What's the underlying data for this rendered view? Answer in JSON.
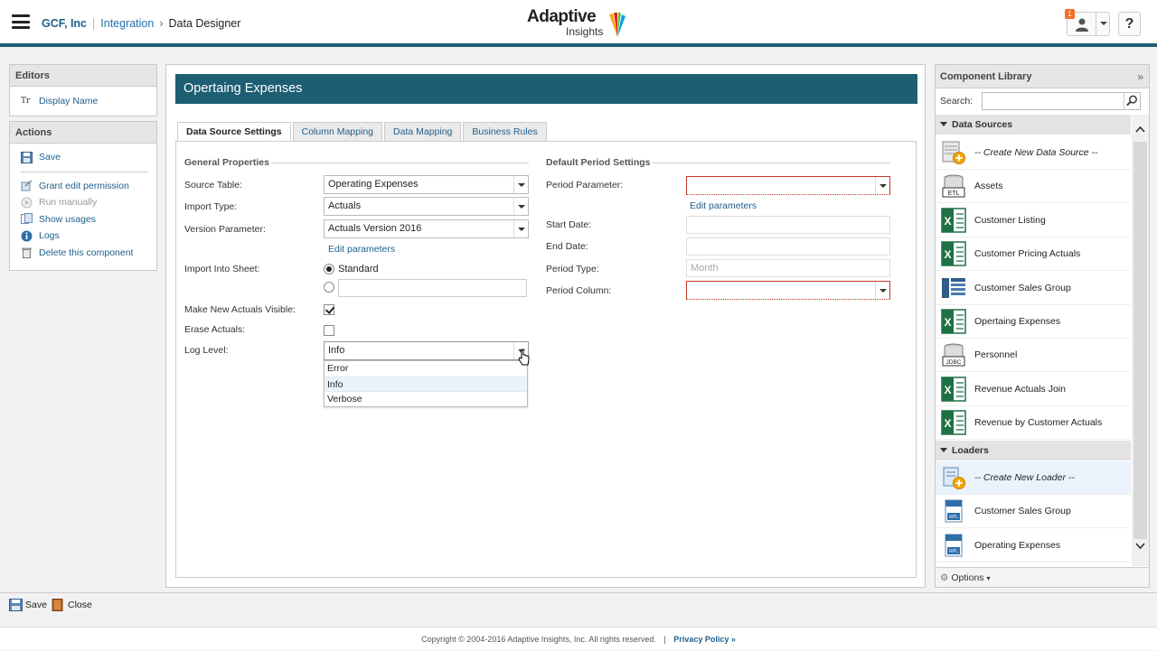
{
  "header": {
    "company": "GCF, Inc",
    "crumb_integration": "Integration",
    "crumb_current": "Data Designer",
    "logo_line1": "Adaptive",
    "logo_line2": "Insights",
    "notification_count": "1",
    "help_label": "?"
  },
  "left": {
    "editors_title": "Editors",
    "display_name": "Display Name",
    "actions_title": "Actions",
    "save": "Save",
    "grant": "Grant edit permission",
    "run_manually": "Run manually",
    "show_usages": "Show usages",
    "logs": "Logs",
    "delete": "Delete this component"
  },
  "main": {
    "title": "Opertaing Expenses",
    "tabs": [
      "Data Source Settings",
      "Column Mapping",
      "Data Mapping",
      "Business Rules"
    ],
    "general": {
      "title": "General Properties",
      "source_table_label": "Source Table:",
      "source_table_value": "Operating Expenses",
      "import_type_label": "Import Type:",
      "import_type_value": "Actuals",
      "version_param_label": "Version Parameter:",
      "version_param_value": "Actuals Version 2016",
      "edit_parameters": "Edit parameters",
      "import_sheet_label": "Import Into Sheet:",
      "standard_option": "Standard",
      "make_visible_label": "Make New Actuals Visible:",
      "erase_label": "Erase Actuals:",
      "log_level_label": "Log Level:",
      "log_level_value": "Info",
      "log_options": [
        "Error",
        "Info",
        "Verbose"
      ]
    },
    "period": {
      "title": "Default Period Settings",
      "period_param_label": "Period Parameter:",
      "edit_parameters": "Edit parameters",
      "start_date_label": "Start Date:",
      "end_date_label": "End Date:",
      "period_type_label": "Period Type:",
      "period_type_placeholder": "Month",
      "period_column_label": "Period Column:"
    }
  },
  "library": {
    "title": "Component Library",
    "collapse": "»",
    "search_label": "Search:",
    "data_sources_title": "Data Sources",
    "data_sources": [
      {
        "label": "-- Create New Data Source --",
        "icon": "new-datasource-icon"
      },
      {
        "label": "Assets",
        "icon": "etl-icon"
      },
      {
        "label": "Customer Listing",
        "icon": "excel-icon"
      },
      {
        "label": "Customer Pricing Actuals",
        "icon": "excel-icon"
      },
      {
        "label": "Customer Sales Group",
        "icon": "table-icon"
      },
      {
        "label": "Opertaing Expenses",
        "icon": "excel-icon"
      },
      {
        "label": "Personnel",
        "icon": "jdbc-icon"
      },
      {
        "label": "Revenue Actuals Join",
        "icon": "excel-icon"
      },
      {
        "label": "Revenue by Customer Actuals",
        "icon": "excel-icon"
      }
    ],
    "loaders_title": "Loaders",
    "loaders": [
      {
        "label": "-- Create New Loader --",
        "icon": "new-loader-icon"
      },
      {
        "label": "Customer Sales Group",
        "icon": "loader-icon"
      },
      {
        "label": "Operating Expenses",
        "icon": "loader-icon"
      }
    ],
    "options": "Options"
  },
  "bottom": {
    "save": "Save",
    "close": "Close"
  },
  "footer": {
    "copyright": "Copyright © 2004-2016 Adaptive Insights, Inc. All rights reserved.",
    "sep": "|",
    "privacy": "Privacy Policy »"
  }
}
